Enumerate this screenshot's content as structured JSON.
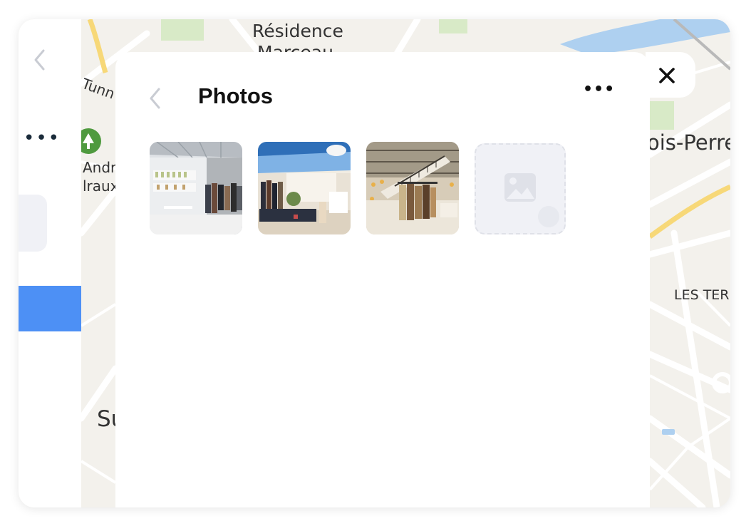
{
  "map": {
    "labels": {
      "residence_line1": "Résidence",
      "residence_line2": "Marceau",
      "tunnel": "Tunn",
      "andre": "André",
      "malraux": "lraux",
      "bois_perret": "ois-Perre",
      "les_ter": "LES TER",
      "su": "Su"
    },
    "colors": {
      "background": "#f3f1ec",
      "road": "#ffffff",
      "highway": "#f7d878",
      "water": "#aed0f0",
      "park": "#d8eac7",
      "park_pin": "#4f9a3f"
    }
  },
  "left_panel": {
    "back_icon": "chevron-left-icon",
    "more_label": "•••",
    "accent": "#4d90f5"
  },
  "sheet": {
    "title": "Photos",
    "back_icon": "chevron-left-icon",
    "more_label": "•••",
    "photos": [
      {
        "icon": "store-photo-white-gallery"
      },
      {
        "icon": "store-photo-blue-ceiling"
      },
      {
        "icon": "store-photo-atrium-stairs"
      }
    ],
    "add_photo_icon": "image-placeholder-icon"
  },
  "close_icon": "close-icon"
}
